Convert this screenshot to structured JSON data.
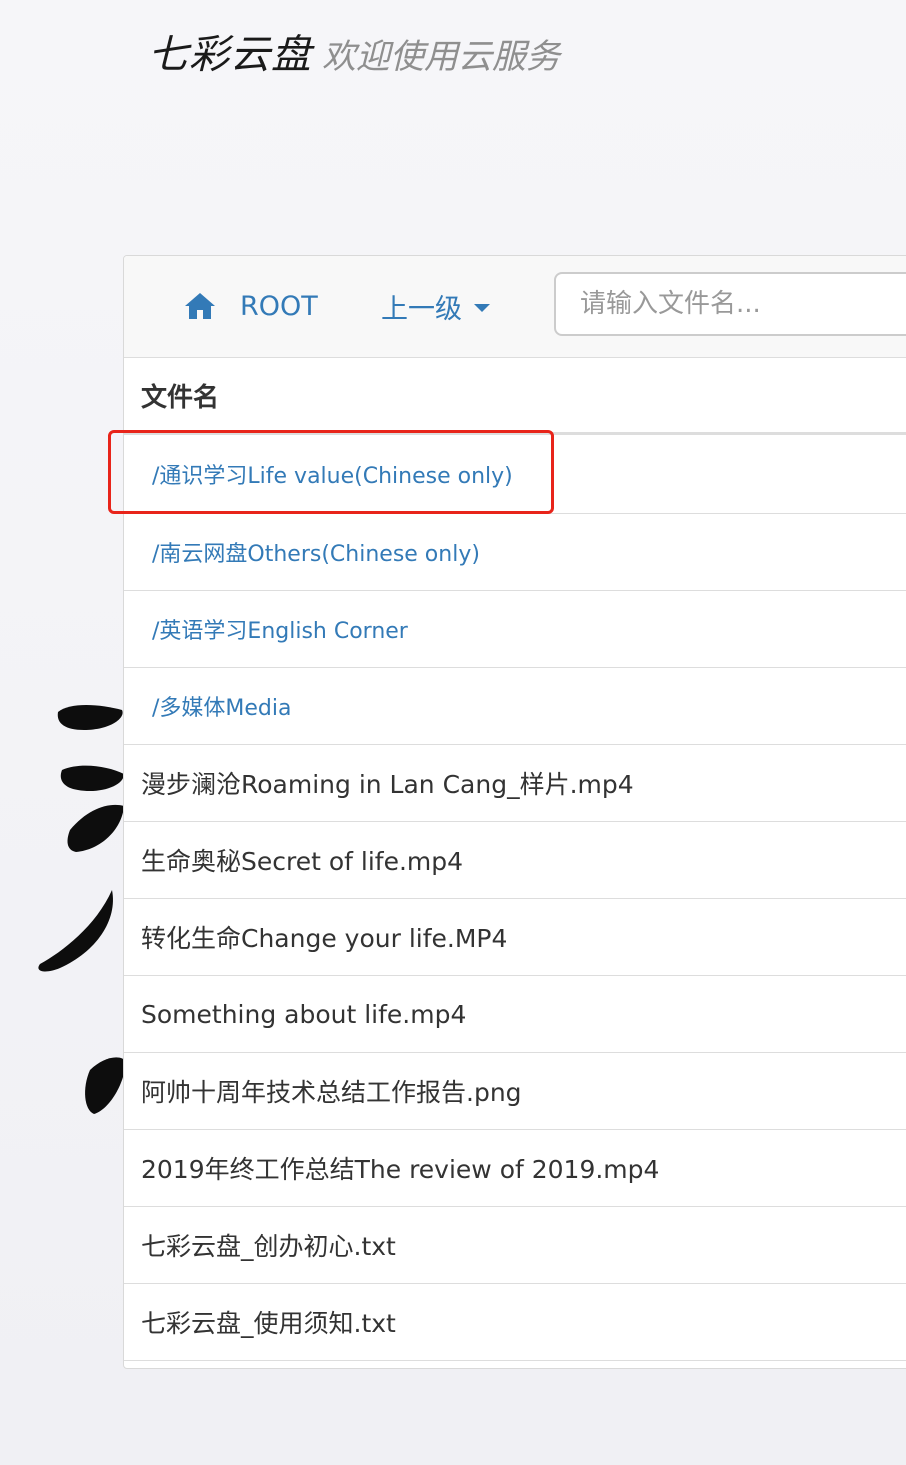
{
  "header": {
    "brand": "七彩云盘",
    "tagline": "欢迎使用云服务"
  },
  "toolbar": {
    "root_label": "ROOT",
    "up_label": "上一级",
    "search_placeholder": "请输入文件名..."
  },
  "table": {
    "column_header": "文件名",
    "folders": [
      "/通识学习Life value(Chinese only)",
      "/南云网盘Others(Chinese only)",
      "/英语学习English Corner",
      "/多媒体Media"
    ],
    "files": [
      "漫步澜沧Roaming in Lan Cang_样片.mp4",
      "生命奥秘Secret of life.mp4",
      "转化生命Change your life.MP4",
      "Something about life.mp4",
      "阿帅十周年技术总结工作报告.png",
      "2019年终工作总结The review of 2019.mp4",
      "七彩云盘_创办初心.txt",
      "七彩云盘_使用须知.txt"
    ]
  },
  "colors": {
    "link": "#337ab7",
    "highlight": "#e8241a"
  }
}
